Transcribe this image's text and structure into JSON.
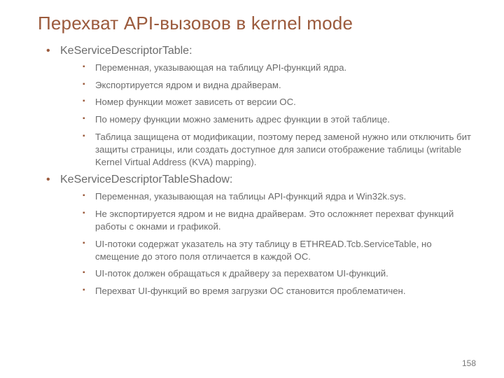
{
  "title": "Перехват API-вызовов в kernel mode",
  "section1": {
    "heading": "KeServiceDescriptorTable:",
    "items": [
      "Переменная, указывающая на таблицу API-функций ядра.",
      "Экспортируется ядром и видна драйверам.",
      "Номер функции может зависеть от версии ОС.",
      "По номеру функции можно заменить адрес функции в этой таблице.",
      "Таблица защищена от модификации, поэтому перед заменой нужно или отключить бит защиты страницы, или создать доступное для записи отображение таблицы (writable Kernel Virtual Address (KVA) mapping)."
    ]
  },
  "section2": {
    "heading": "KeServiceDescriptorTableShadow:",
    "items": [
      "Переменная, указывающая на таблицы API-функций ядра и Win32k.sys.",
      "Не экспортируется ядром и не видна драйверам. Это осложняет перехват функций работы с окнами и графикой.",
      "UI-потоки содержат указатель на эту таблицу в ETHREAD.Tcb.ServiceTable, но смещение до этого поля отличается в каждой ОС.",
      "UI-поток должен обращаться к драйверу за перехватом UI-функций.",
      "Перехват UI-функций во время загрузки ОС становится проблематичен."
    ]
  },
  "page_number": "158"
}
